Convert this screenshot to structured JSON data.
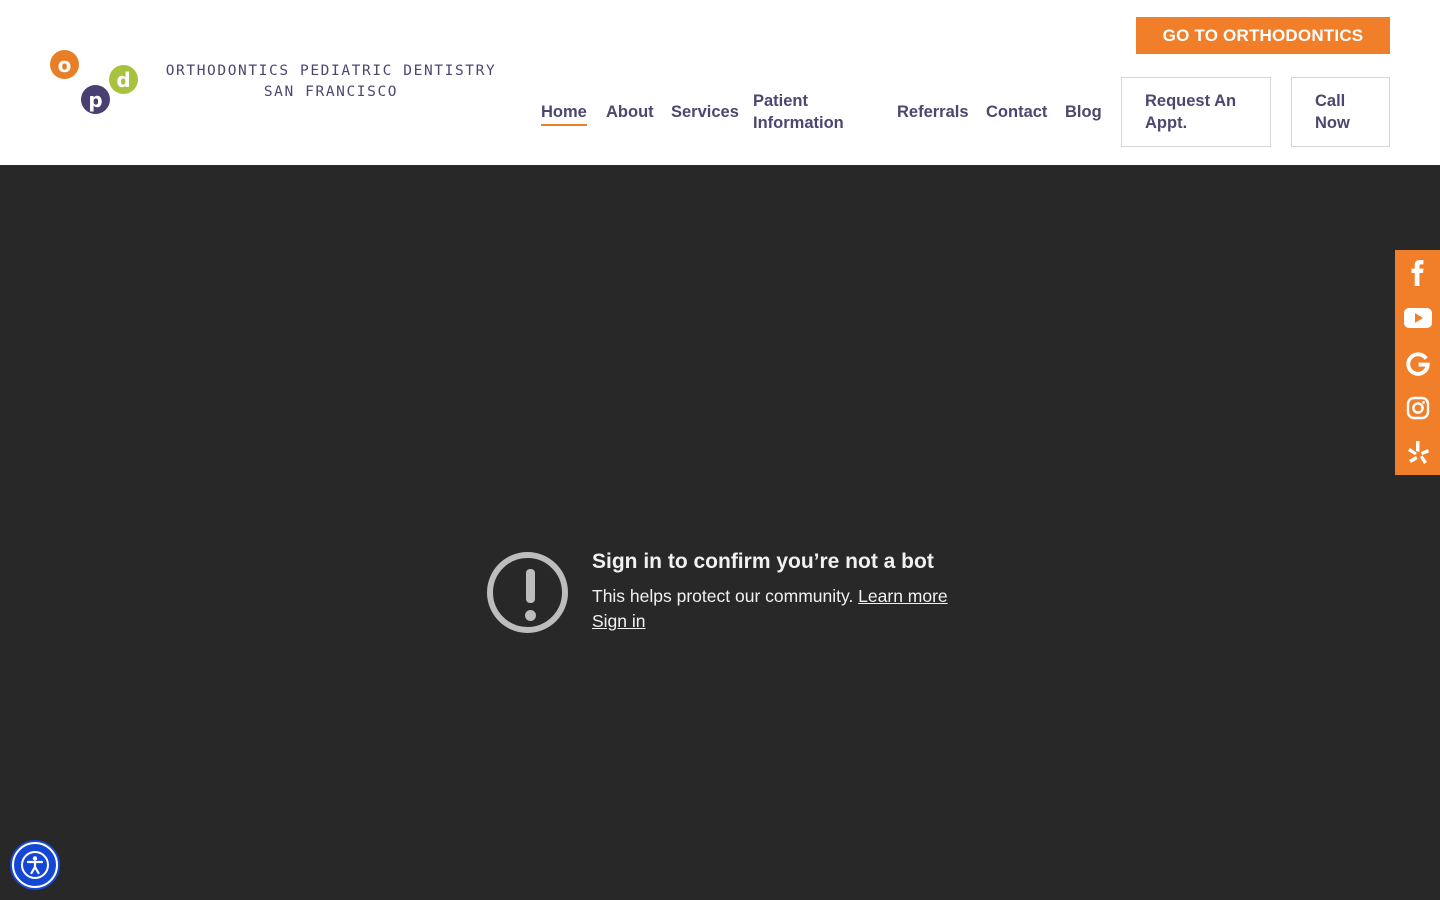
{
  "logo": {
    "letters": [
      "o",
      "p",
      "d"
    ],
    "line1": "ORTHODONTICS PEDIATRIC DENTISTRY",
    "line2": "SAN FRANCISCO"
  },
  "header": {
    "cta_label": "GO TO ORTHODONTICS",
    "nav": {
      "home": "Home",
      "about": "About",
      "services": "Services",
      "patient_line1": "Patient",
      "patient_line2": "Information",
      "referrals": "Referrals",
      "contact": "Contact",
      "blog": "Blog"
    },
    "request_line1": "Request An",
    "request_line2": "Appt.",
    "call_line1": "Call",
    "call_line2": "Now"
  },
  "embed": {
    "title": "Sign in to confirm you’re not a bot",
    "body": "This helps protect our community. ",
    "learn_more": "Learn more",
    "sign_in": "Sign in"
  },
  "social": [
    "facebook-icon",
    "youtube-icon",
    "google-icon",
    "instagram-icon",
    "yelp-icon"
  ],
  "colors": {
    "accent": "#f17f2a",
    "brand_purple": "#4e4570",
    "logo_green": "#a6c23f",
    "video_bg": "#282828",
    "accessibility_blue": "#1447d6"
  }
}
